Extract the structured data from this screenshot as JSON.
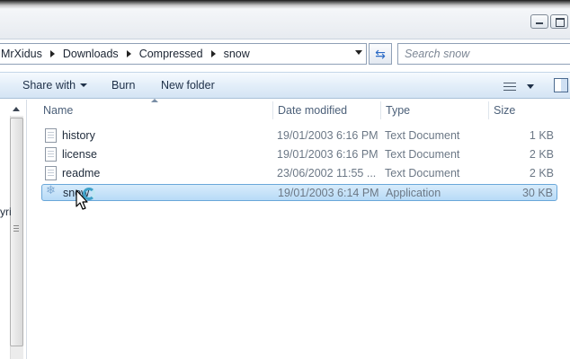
{
  "window": {
    "minimize_label": "Minimize",
    "maximize_label": "Maximize"
  },
  "address": {
    "breadcrumbs": [
      "MrXidus",
      "Downloads",
      "Compressed",
      "snow"
    ]
  },
  "search": {
    "placeholder": "Search snow"
  },
  "toolbar": {
    "share_label": "Share with",
    "burn_label": "Burn",
    "new_folder_label": "New folder"
  },
  "nav": {
    "partial_text": "yri"
  },
  "columns": {
    "name": "Name",
    "date": "Date modified",
    "type": "Type",
    "size": "Size"
  },
  "files": [
    {
      "name": "history",
      "date": "19/01/2003 6:16 PM",
      "type": "Text Document",
      "size": "1 KB",
      "icon": "text-document-icon"
    },
    {
      "name": "license",
      "date": "19/01/2003 6:16 PM",
      "type": "Text Document",
      "size": "2 KB",
      "icon": "text-document-icon"
    },
    {
      "name": "readme",
      "date": "23/06/2002 11:55 ...",
      "type": "Text Document",
      "size": "2 KB",
      "icon": "text-document-icon"
    },
    {
      "name": "snow",
      "date": "19/01/2003 6:14 PM",
      "type": "Application",
      "size": "30 KB",
      "icon": "snowflake-app-icon",
      "selected": true
    }
  ],
  "colors": {
    "accent": "#6aa7d9",
    "selection": "#b7dbf7",
    "toolbar": "#dbe8f6"
  }
}
